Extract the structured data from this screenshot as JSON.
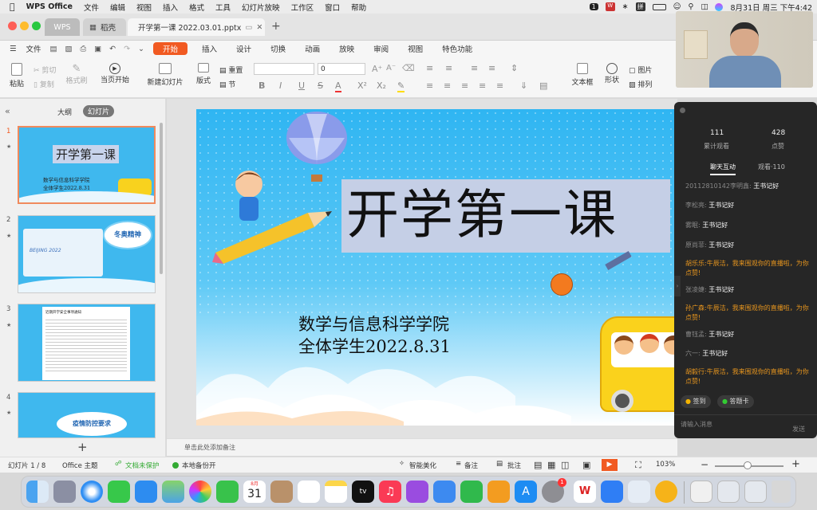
{
  "menubar": {
    "app": "WPS Office",
    "items": [
      "文件",
      "编辑",
      "视图",
      "插入",
      "格式",
      "工具",
      "幻灯片放映",
      "工作区",
      "窗口",
      "帮助"
    ],
    "badge": "1",
    "input_method": "拼",
    "datetime": "8月31日 周三 下午4:42"
  },
  "tabs": {
    "home": "WPS",
    "docer": "稻壳",
    "file": "开学第一课 2022.03.01.pptx",
    "add": "+"
  },
  "ribbon": {
    "file_menu": "文件",
    "tabs": [
      "开始",
      "插入",
      "设计",
      "切换",
      "动画",
      "放映",
      "审阅",
      "视图",
      "特色功能"
    ],
    "active": "开始"
  },
  "toolbar": {
    "paste": "粘贴",
    "cut": "剪切",
    "copy": "复制",
    "format_painter": "格式刷",
    "from_current": "当页开始",
    "new_slide": "新建幻灯片",
    "layout": "版式",
    "reset": "重置",
    "section": "节",
    "font_size": "0",
    "textbox": "文本框",
    "shape": "形状",
    "picture": "图片",
    "arrange": "排列"
  },
  "leftpane": {
    "tab_outline": "大纲",
    "tab_slides": "幻灯片",
    "slides": [
      {
        "num": "1",
        "title": "开学第一课",
        "sub1": "数学与信息科学学院",
        "sub2": "全体学生2022.8.31"
      },
      {
        "num": "2",
        "title": "冬奥精神",
        "logo": "BEIJING 2022"
      },
      {
        "num": "3",
        "title": "近期开学安全事项通知"
      },
      {
        "num": "4",
        "title": "疫情防控要求"
      }
    ],
    "add_button": "+"
  },
  "slide": {
    "title": "开学第一课",
    "line1": "数学与信息科学学院",
    "line2": "全体学生2022.8.31"
  },
  "notes_placeholder": "单击此处添加备注",
  "status": {
    "slide_counter": "幻灯片 1 / 8",
    "theme": "Office 主题",
    "protect": "文档未保护",
    "backup": "本地备份开",
    "beautify": "智能美化",
    "notes": "备注",
    "comments": "批注",
    "zoom": "103%"
  },
  "live": {
    "views_count": "111",
    "views_label": "累计观看",
    "likes_count": "428",
    "likes_label": "点赞",
    "tab_chat": "聊天互动",
    "tab_viewers": "观看·110",
    "messages": [
      {
        "name": "20112810142李明鑫:",
        "text": "王书记好",
        "orange": false
      },
      {
        "name": "李松亮:",
        "text": "王书记好",
        "orange": false
      },
      {
        "name": "雾眠:",
        "text": "王书记好",
        "orange": false
      },
      {
        "name": "原尚菲:",
        "text": "王书记好",
        "orange": false
      },
      {
        "name": "胡乐乐:",
        "text": "牛辰洁，我来围观你的直播啦，为你点赞!",
        "orange": true
      },
      {
        "name": "张凌婕:",
        "text": "王书记好",
        "orange": false
      },
      {
        "name": "孙广森:",
        "text": "牛辰洁，我来围观你的直播啦，为你点赞!",
        "orange": true
      },
      {
        "name": "曹钰孟:",
        "text": "王书记好",
        "orange": false
      },
      {
        "name": "六一:",
        "text": "王书记好",
        "orange": false
      },
      {
        "name": "胡毅行:",
        "text": "牛辰洁，我来围观你的直播啦，为你点赞!",
        "orange": true
      }
    ],
    "btn_checkin": "签到",
    "btn_quiz": "答题卡",
    "input_placeholder": "请输入消息",
    "send": "发送"
  },
  "dock": {
    "calendar_month": "8月",
    "calendar_day": "31",
    "settings_badge": "1",
    "appletv": "tv"
  },
  "colors": {
    "accent": "#f15a22",
    "slide_sky": "#2fb5f2",
    "live_bg": "#262626",
    "chat_orange": "#e8961e"
  }
}
